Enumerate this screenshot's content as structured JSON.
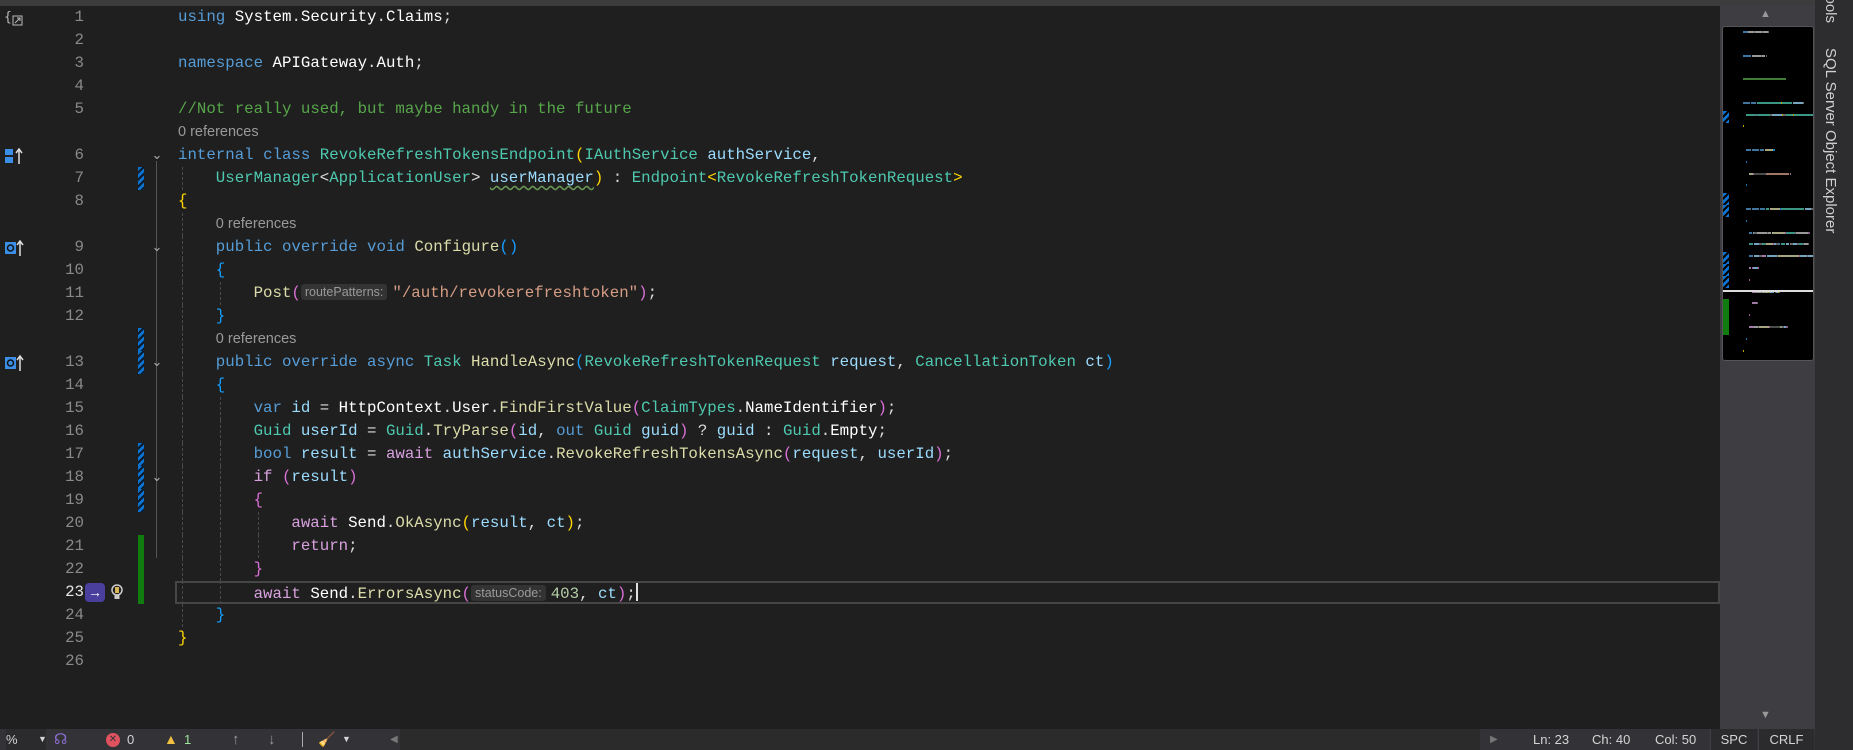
{
  "side_panel": {
    "tools_label": "Tools",
    "sql_explorer_label": "SQL Server Object Explorer"
  },
  "editor": {
    "current_line": 23,
    "lines": [
      {
        "num": 1,
        "indent": 0,
        "glyph": "usings",
        "tokens": [
          [
            "using",
            "kw"
          ],
          [
            " ",
            "pl"
          ],
          [
            "System",
            "wh"
          ],
          [
            ".",
            "pl"
          ],
          [
            "Security",
            "wh"
          ],
          [
            ".",
            "pl"
          ],
          [
            "Claims",
            "wh"
          ],
          [
            ";",
            "pl"
          ]
        ]
      },
      {
        "num": 2,
        "indent": 0,
        "tokens": []
      },
      {
        "num": 3,
        "indent": 0,
        "tokens": [
          [
            "namespace",
            "kw"
          ],
          [
            " ",
            "pl"
          ],
          [
            "APIGateway",
            "wh"
          ],
          [
            ".",
            "pl"
          ],
          [
            "Auth",
            "wh"
          ],
          [
            ";",
            "pl"
          ]
        ]
      },
      {
        "num": 4,
        "indent": 0,
        "tokens": []
      },
      {
        "num": 5,
        "indent": 0,
        "tokens": [
          [
            "//Not really used, but maybe handy in the future",
            "cmt"
          ]
        ]
      },
      {
        "refs": "0 references",
        "indent": 0
      },
      {
        "num": 6,
        "indent": 0,
        "fold": true,
        "glyph": "class-implements",
        "tokens": [
          [
            "internal",
            "kw"
          ],
          [
            " ",
            "pl"
          ],
          [
            "class",
            "kw"
          ],
          [
            " ",
            "pl"
          ],
          [
            "RevokeRefreshTokensEndpoint",
            "typ"
          ],
          [
            "(",
            "b1"
          ],
          [
            "IAuthService",
            "typ"
          ],
          [
            " ",
            "pl"
          ],
          [
            "authService",
            "var"
          ],
          [
            ",",
            "pl"
          ]
        ]
      },
      {
        "num": 7,
        "indent": 1,
        "change": "mod",
        "tokens": [
          [
            "UserManager",
            "typ"
          ],
          [
            "<",
            "pl"
          ],
          [
            "ApplicationUser",
            "typ"
          ],
          [
            "> ",
            "pl"
          ],
          [
            "userManager",
            "var squig"
          ],
          [
            ")",
            "b1"
          ],
          [
            " : ",
            "pl"
          ],
          [
            "Endpoint",
            "typ"
          ],
          [
            "<",
            "b1"
          ],
          [
            "RevokeRefreshTokenRequest",
            "typ"
          ],
          [
            ">",
            "b1"
          ]
        ]
      },
      {
        "num": 8,
        "indent": 0,
        "tokens": [
          [
            "{",
            "b1"
          ]
        ]
      },
      {
        "refs": "0 references",
        "indent": 1
      },
      {
        "num": 9,
        "indent": 1,
        "fold": true,
        "glyph": "override",
        "tokens": [
          [
            "public",
            "kw"
          ],
          [
            " ",
            "pl"
          ],
          [
            "override",
            "kw"
          ],
          [
            " ",
            "pl"
          ],
          [
            "void",
            "kw"
          ],
          [
            " ",
            "pl"
          ],
          [
            "Configure",
            "fn"
          ],
          [
            "()",
            "b3"
          ]
        ]
      },
      {
        "num": 10,
        "indent": 1,
        "tokens": [
          [
            "{",
            "b3"
          ]
        ]
      },
      {
        "num": 11,
        "indent": 2,
        "tokens": [
          [
            "Post",
            "fn"
          ],
          [
            "(",
            "b2"
          ],
          [
            "routePatterns:",
            "hint"
          ],
          [
            "\"/auth/revokerefreshtoken\"",
            "str"
          ],
          [
            ")",
            "b2"
          ],
          [
            ";",
            "pl"
          ]
        ]
      },
      {
        "num": 12,
        "indent": 1,
        "tokens": [
          [
            "}",
            "b3"
          ]
        ]
      },
      {
        "refs": "0 references",
        "indent": 1,
        "change": "mod"
      },
      {
        "num": 13,
        "indent": 1,
        "fold": true,
        "change": "mod",
        "glyph": "override",
        "tokens": [
          [
            "public",
            "kw"
          ],
          [
            " ",
            "pl"
          ],
          [
            "override",
            "kw"
          ],
          [
            " ",
            "pl"
          ],
          [
            "async",
            "kw"
          ],
          [
            " ",
            "pl"
          ],
          [
            "Task",
            "typ"
          ],
          [
            " ",
            "pl"
          ],
          [
            "HandleAsync",
            "fn"
          ],
          [
            "(",
            "b3"
          ],
          [
            "RevokeRefreshTokenRequest",
            "typ"
          ],
          [
            " ",
            "pl"
          ],
          [
            "request",
            "var"
          ],
          [
            ", ",
            "pl"
          ],
          [
            "CancellationToken",
            "typ"
          ],
          [
            " ",
            "pl"
          ],
          [
            "ct",
            "var"
          ],
          [
            ")",
            "b3"
          ]
        ]
      },
      {
        "num": 14,
        "indent": 1,
        "tokens": [
          [
            "{",
            "b3"
          ]
        ]
      },
      {
        "num": 15,
        "indent": 2,
        "tokens": [
          [
            "var",
            "kw"
          ],
          [
            " ",
            "pl"
          ],
          [
            "id",
            "var"
          ],
          [
            " = ",
            "pl"
          ],
          [
            "HttpContext",
            "wh"
          ],
          [
            ".",
            "pl"
          ],
          [
            "User",
            "wh"
          ],
          [
            ".",
            "pl"
          ],
          [
            "FindFirstValue",
            "fn"
          ],
          [
            "(",
            "b2"
          ],
          [
            "ClaimTypes",
            "typ"
          ],
          [
            ".",
            "pl"
          ],
          [
            "NameIdentifier",
            "wh"
          ],
          [
            ")",
            "b2"
          ],
          [
            ";",
            "pl"
          ]
        ]
      },
      {
        "num": 16,
        "indent": 2,
        "tokens": [
          [
            "Guid",
            "typ"
          ],
          [
            " ",
            "pl"
          ],
          [
            "userId",
            "var"
          ],
          [
            " = ",
            "pl"
          ],
          [
            "Guid",
            "typ"
          ],
          [
            ".",
            "pl"
          ],
          [
            "TryParse",
            "fn"
          ],
          [
            "(",
            "b2"
          ],
          [
            "id",
            "var"
          ],
          [
            ", ",
            "pl"
          ],
          [
            "out",
            "kw"
          ],
          [
            " ",
            "pl"
          ],
          [
            "Guid",
            "typ"
          ],
          [
            " ",
            "pl"
          ],
          [
            "guid",
            "var"
          ],
          [
            ")",
            "b2"
          ],
          [
            " ? ",
            "pl"
          ],
          [
            "guid",
            "var"
          ],
          [
            " : ",
            "pl"
          ],
          [
            "Guid",
            "typ"
          ],
          [
            ".",
            "pl"
          ],
          [
            "Empty",
            "wh"
          ],
          [
            ";",
            "pl"
          ]
        ]
      },
      {
        "num": 17,
        "indent": 2,
        "change": "mod",
        "tokens": [
          [
            "bool",
            "kw"
          ],
          [
            " ",
            "pl"
          ],
          [
            "result",
            "var"
          ],
          [
            " = ",
            "pl"
          ],
          [
            "await",
            "ctl"
          ],
          [
            " ",
            "pl"
          ],
          [
            "authService",
            "var"
          ],
          [
            ".",
            "pl"
          ],
          [
            "RevokeRefreshTokensAsync",
            "fn"
          ],
          [
            "(",
            "b2"
          ],
          [
            "request",
            "var"
          ],
          [
            ", ",
            "pl"
          ],
          [
            "userId",
            "var"
          ],
          [
            ")",
            "b2"
          ],
          [
            ";",
            "pl"
          ]
        ]
      },
      {
        "num": 18,
        "indent": 2,
        "fold": true,
        "change": "mod",
        "tokens": [
          [
            "if",
            "ctl"
          ],
          [
            " ",
            "pl"
          ],
          [
            "(",
            "b2"
          ],
          [
            "result",
            "var"
          ],
          [
            ")",
            "b2"
          ]
        ]
      },
      {
        "num": 19,
        "indent": 2,
        "change": "mod",
        "tokens": [
          [
            "{",
            "b2"
          ]
        ]
      },
      {
        "num": 20,
        "indent": 3,
        "tokens": [
          [
            "await",
            "ctl"
          ],
          [
            " ",
            "pl"
          ],
          [
            "Send",
            "wh"
          ],
          [
            ".",
            "pl"
          ],
          [
            "OkAsync",
            "fn"
          ],
          [
            "(",
            "b1"
          ],
          [
            "result",
            "var"
          ],
          [
            ", ",
            "pl"
          ],
          [
            "ct",
            "var"
          ],
          [
            ")",
            "b1"
          ],
          [
            ";",
            "pl"
          ]
        ]
      },
      {
        "num": 21,
        "indent": 3,
        "change": "saved",
        "tokens": [
          [
            "return",
            "ctl"
          ],
          [
            ";",
            "pl"
          ]
        ]
      },
      {
        "num": 22,
        "indent": 2,
        "change": "saved",
        "tokens": [
          [
            "}",
            "b2"
          ]
        ]
      },
      {
        "num": 23,
        "indent": 2,
        "change": "saved",
        "current": true,
        "tokens": [
          [
            "await",
            "ctl"
          ],
          [
            " ",
            "pl"
          ],
          [
            "Send",
            "wh"
          ],
          [
            ".",
            "pl"
          ],
          [
            "ErrorsAsync",
            "fn"
          ],
          [
            "(",
            "b2"
          ],
          [
            "statusCode:",
            "hint"
          ],
          [
            "403",
            "num"
          ],
          [
            ", ",
            "pl"
          ],
          [
            "ct",
            "var"
          ],
          [
            ")",
            "b2"
          ],
          [
            ";",
            "pl"
          ]
        ]
      },
      {
        "num": 24,
        "indent": 1,
        "tokens": [
          [
            "}",
            "b3"
          ]
        ]
      },
      {
        "num": 25,
        "indent": 0,
        "tokens": [
          [
            "}",
            "b1"
          ]
        ]
      },
      {
        "num": 26,
        "indent": 0,
        "tokens": []
      }
    ]
  },
  "status_bar": {
    "zoom": "%",
    "errors": "0",
    "warnings": "1",
    "line": "Ln: 23",
    "char": "Ch: 40",
    "col": "Col: 50",
    "whitespace": "SPC",
    "line_endings": "CRLF"
  },
  "colors": {
    "accent": "#4b3f9e",
    "modified": "#0b72d0",
    "saved": "#107c10"
  }
}
